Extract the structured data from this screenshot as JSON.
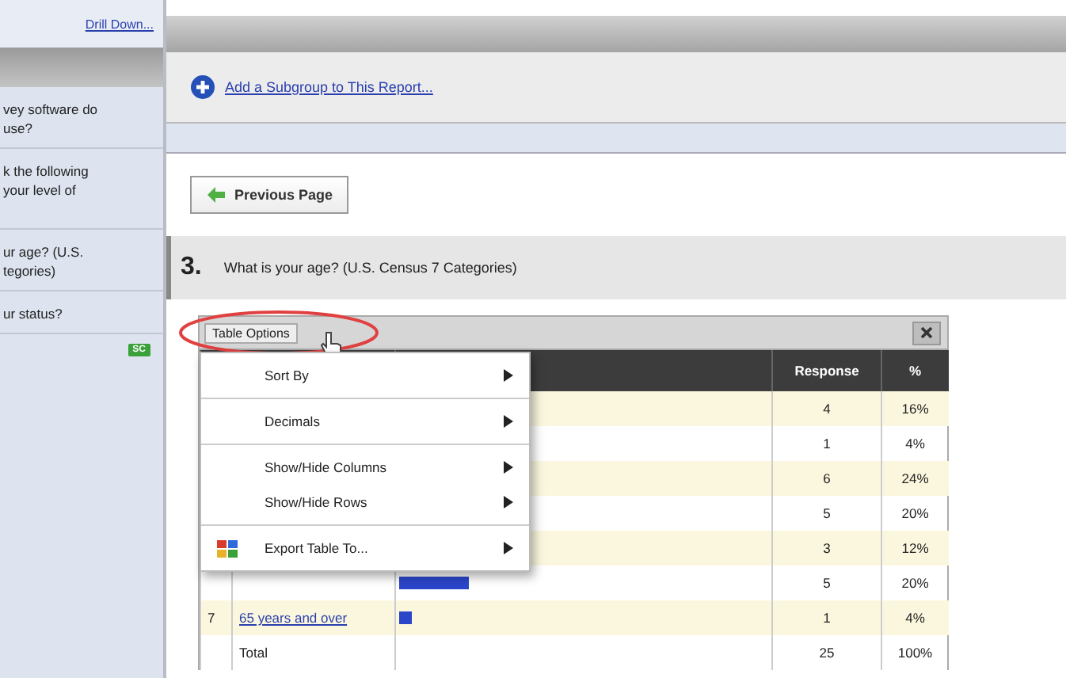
{
  "sidebar": {
    "drill_down": "Drill Down...",
    "items": [
      {
        "lines": [
          "vey software do",
          "use?"
        ]
      },
      {
        "lines": [
          "k the following",
          "your level of"
        ]
      },
      {
        "lines": [
          "ur age? (U.S.",
          "tegories)"
        ]
      },
      {
        "lines": [
          "ur status?"
        ]
      }
    ],
    "badge": "SC"
  },
  "subgroup_link": "Add a Subgroup to This Report...",
  "previous_button": "Previous Page",
  "question": {
    "number": "3.",
    "text": "What is your age? (U.S. Census 7 Categories)"
  },
  "table": {
    "options_button": "Table Options",
    "columns": [
      "Response",
      "%"
    ],
    "rows": [
      {
        "response": "4",
        "percent": "16%"
      },
      {
        "response": "1",
        "percent": "4%"
      },
      {
        "response": "6",
        "percent": "24%"
      },
      {
        "response": "5",
        "percent": "20%"
      },
      {
        "response": "3",
        "percent": "12%"
      },
      {
        "level": 0.19,
        "response": "5",
        "percent": "20%"
      },
      {
        "number": "7",
        "label": "65 years and over",
        "level": 0.035,
        "response": "1",
        "percent": "4%"
      }
    ],
    "total": {
      "label": "Total",
      "response": "25",
      "percent": "100%"
    }
  },
  "menu": {
    "items": [
      {
        "kind": "item",
        "label": "Sort By"
      },
      {
        "kind": "divider"
      },
      {
        "kind": "item",
        "label": "Decimals"
      },
      {
        "kind": "divider"
      },
      {
        "kind": "item",
        "label": "Show/Hide Columns"
      },
      {
        "kind": "item",
        "label": "Show/Hide Rows"
      },
      {
        "kind": "divider"
      },
      {
        "kind": "export",
        "label": "Export Table To..."
      }
    ]
  }
}
